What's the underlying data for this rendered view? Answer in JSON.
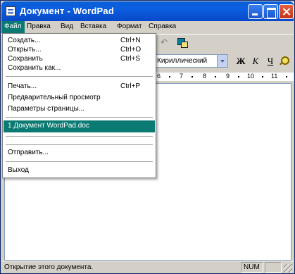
{
  "window": {
    "title": "Документ - WordPad"
  },
  "menubar": [
    {
      "label": "Файл",
      "active": true
    },
    {
      "label": "Правка"
    },
    {
      "label": "Вид"
    },
    {
      "label": "Вставка"
    },
    {
      "label": "Формат"
    },
    {
      "label": "Справка"
    }
  ],
  "file_menu": {
    "items": [
      {
        "label": "Создать...",
        "shortcut": "Ctrl+N"
      },
      {
        "label": "Открыть...",
        "shortcut": "Ctrl+O"
      },
      {
        "label": "Сохранить",
        "shortcut": "Ctrl+S"
      },
      {
        "label": "Сохранить как..."
      },
      {
        "label": "Печать...",
        "shortcut": "Ctrl+P"
      },
      {
        "label": "Предварительный просмотр"
      },
      {
        "label": "Параметры страницы..."
      },
      {
        "label": "1 Документ WordPad.doc",
        "selected": true
      },
      {
        "label": "Отправить..."
      },
      {
        "label": "Выход"
      }
    ]
  },
  "formatbar": {
    "charset": "Кириллический",
    "bold_label": "Ж",
    "italic_label": "К",
    "underline_label": "Ч"
  },
  "ruler": {
    "numbers": [
      "6",
      "7",
      "8",
      "9",
      "10",
      "11"
    ]
  },
  "statusbar": {
    "text": "Открытие этого документа.",
    "num": "NUM"
  },
  "colors": {
    "title_bar": "#0a5fd8",
    "menu_highlight": "#0a7a73",
    "chrome": "#d4d0c8"
  }
}
